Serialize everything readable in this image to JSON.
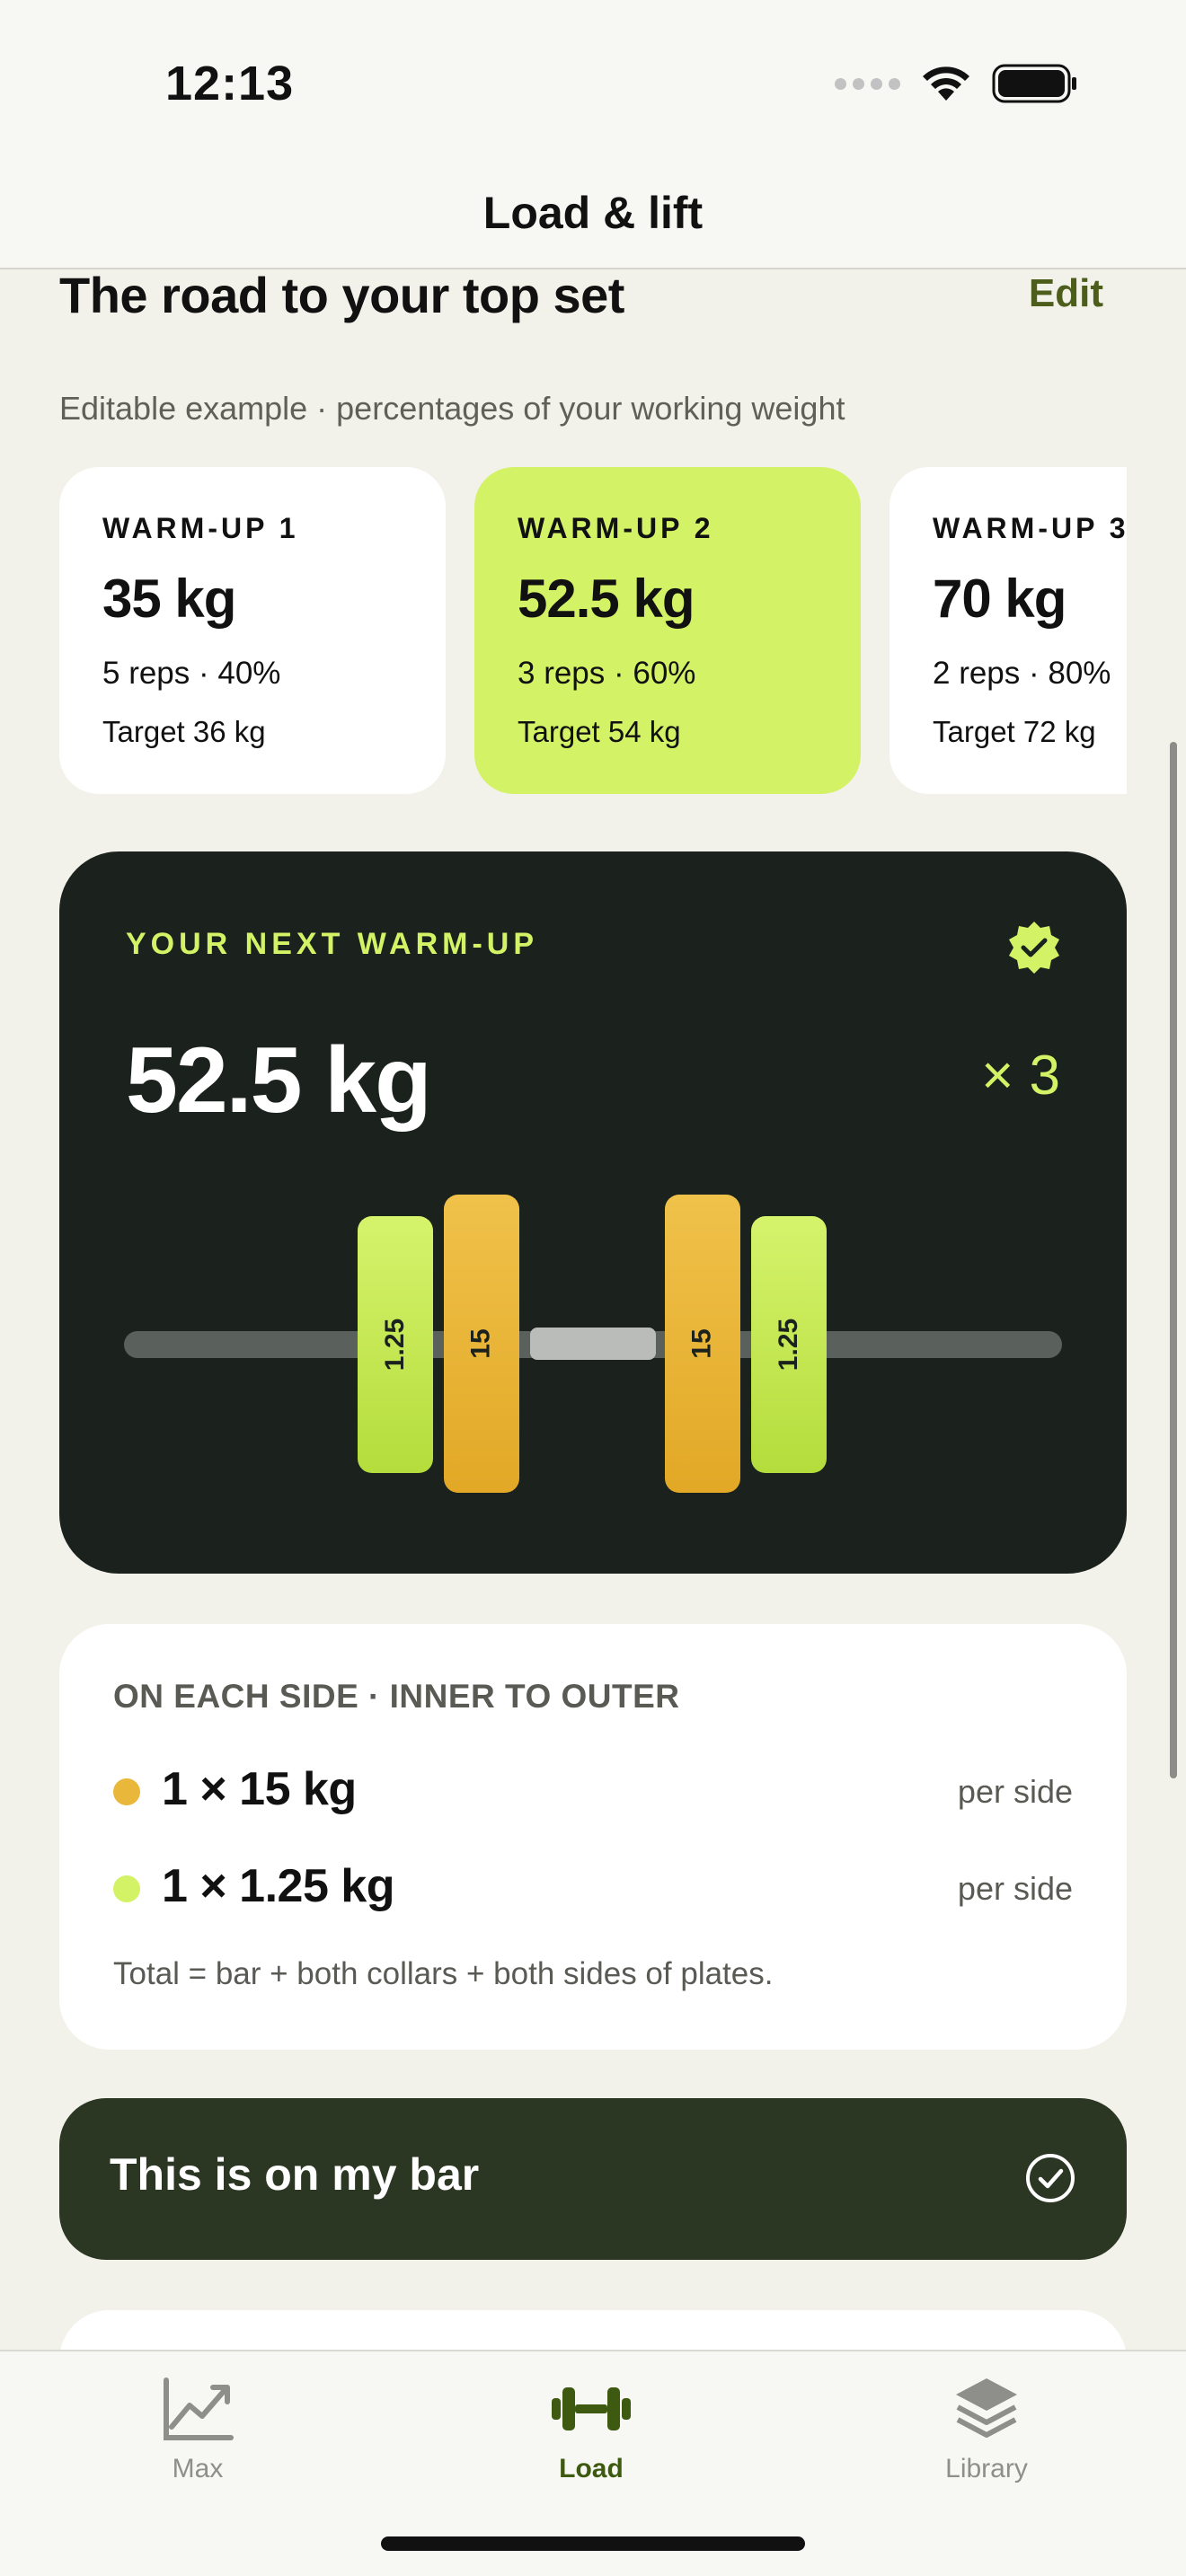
{
  "status": {
    "time": "12:13"
  },
  "header": {
    "title": "Load & lift"
  },
  "section": {
    "title": "The road to your top set",
    "edit_label": "Edit",
    "subtitle": "Editable example · percentages of your working weight"
  },
  "warmups": [
    {
      "label": "WARM-UP 1",
      "weight": "35 kg",
      "reps": "5 reps · 40%",
      "target": "Target 36 kg",
      "active": false
    },
    {
      "label": "WARM-UP 2",
      "weight": "52.5 kg",
      "reps": "3 reps · 60%",
      "target": "Target 54 kg",
      "active": true
    },
    {
      "label": "WARM-UP 3",
      "weight": "70 kg",
      "reps": "2 reps · 80%",
      "target": "Target 72 kg",
      "active": false
    }
  ],
  "hero": {
    "label": "YOUR NEXT WARM-UP",
    "weight": "52.5 kg",
    "reps": "× 3",
    "plates_left": [
      "1.25",
      "15"
    ],
    "plates_right": [
      "15",
      "1.25"
    ]
  },
  "breakdown": {
    "heading": "ON EACH SIDE · INNER TO OUTER",
    "rows": [
      {
        "value": "1 × 15 kg",
        "side": "per side",
        "color": "#e9b83a"
      },
      {
        "value": "1 × 1.25 kg",
        "side": "per side",
        "color": "#d3f266"
      }
    ],
    "note": "Total = bar + both collars + both sides of plates."
  },
  "action": {
    "label": "This is on my bar"
  },
  "tabs": [
    {
      "label": "Max",
      "icon": "chart-line-icon",
      "active": false
    },
    {
      "label": "Load",
      "icon": "dumbbell-icon",
      "active": true
    },
    {
      "label": "Library",
      "icon": "layers-icon",
      "active": false
    }
  ],
  "colors": {
    "accent": "#d3f266",
    "dark_card": "#1b221e",
    "action": "#2b3623",
    "plate_gold": "#e9b83a",
    "background": "#f3f2ea"
  }
}
